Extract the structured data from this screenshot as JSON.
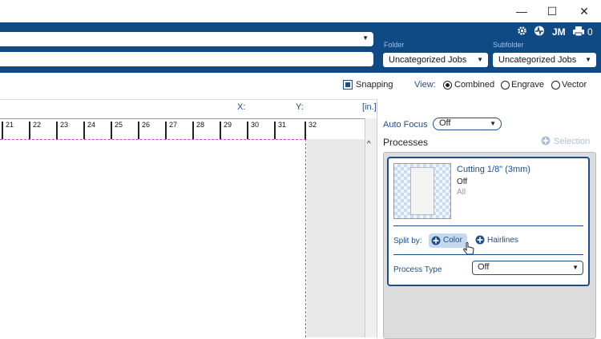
{
  "window": {
    "minimize": "—",
    "maximize": "☐",
    "close": "✕"
  },
  "header": {
    "folder_label": "Folder",
    "folder_value": "Uncategorized Jobs",
    "subfolder_label": "Subfolder",
    "subfolder_value": "Uncategorized Jobs",
    "user_initials": "JM",
    "print_count": "0",
    "icons": [
      "gear-icon",
      "activity-icon",
      "user-initials",
      "printer-icon"
    ]
  },
  "toolbar": {
    "snapping_label": "Snapping",
    "view_label": "View:",
    "view_options": [
      "Combined",
      "Engrave",
      "Vector"
    ],
    "view_selected": "Combined"
  },
  "coords": {
    "x_label": "X:",
    "y_label": "Y:",
    "unit": "[in.]"
  },
  "ruler": {
    "ticks": [
      "21",
      "22",
      "23",
      "24",
      "25",
      "26",
      "27",
      "28",
      "29",
      "30",
      "31",
      "32"
    ]
  },
  "panel": {
    "autofocus_label": "Auto Focus",
    "autofocus_value": "Off",
    "processes_label": "Processes",
    "selection_label": "Selection",
    "process": {
      "name": "Cutting 1/8\" (3mm)",
      "status": "Off",
      "scope": "All"
    },
    "split_by_label": "Split by:",
    "split_color": "Color",
    "split_hairlines": "Hairlines",
    "process_type_label": "Process Type",
    "process_type_value": "Off"
  },
  "colors": {
    "header_bg": "#0f4a84",
    "accent": "#1d4e8a",
    "guide": "#c040c0"
  }
}
